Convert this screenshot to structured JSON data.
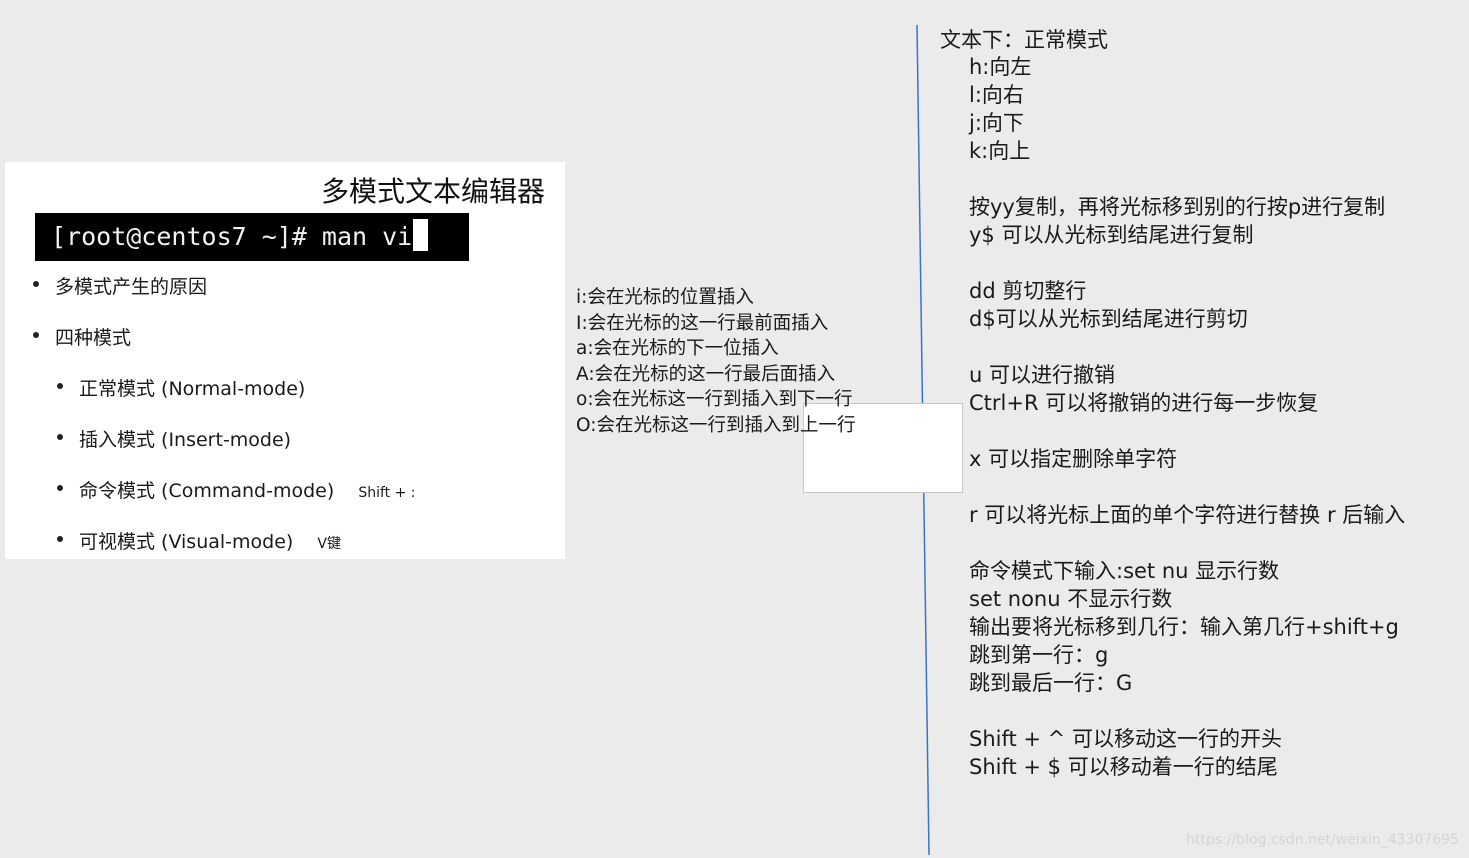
{
  "slide": {
    "title": "多模式文本编辑器",
    "terminal_prompt": "[root@centos7 ~]# man vi",
    "bullets": [
      {
        "label": "多模式产生的原因"
      },
      {
        "label": "四种模式"
      }
    ],
    "modes": [
      {
        "label": "正常模式 (Normal-mode)",
        "note": ""
      },
      {
        "label": "插入模式 (Insert-mode)",
        "note": ""
      },
      {
        "label": "命令模式 (Command-mode)",
        "note": "Shift + :"
      },
      {
        "label": "可视模式 (Visual-mode)",
        "note": "V键"
      }
    ]
  },
  "insert_notes": [
    "i:会在光标的位置插入",
    "I:会在光标的这一行最前面插入",
    "a:会在光标的下一位插入",
    "A:会在光标的这一行最后面插入",
    "o:会在光标这一行到插入到下一行",
    "O:会在光标这一行到插入到上一行"
  ],
  "normal_mode": {
    "heading": "文本下：正常模式",
    "lines": [
      "h:向左",
      "l:向右",
      "j:向下",
      "k:向上",
      "",
      "按yy复制，再将光标移到别的行按p进行复制",
      "y$ 可以从光标到结尾进行复制",
      "",
      "dd 剪切整行",
      "d$可以从光标到结尾进行剪切",
      "",
      "u 可以进行撤销",
      "Ctrl+R 可以将撤销的进行每一步恢复",
      "",
      "x 可以指定删除单字符",
      "",
      "r 可以将光标上面的单个字符进行替换 r 后输入",
      "",
      "命令模式下输入:set nu 显示行数",
      "set nonu 不显示行数",
      "输出要将光标移到几行：输入第几行+shift+g",
      "跳到第一行：g",
      "跳到最后一行：G",
      "",
      "Shift + ^  可以移动这一行的开头",
      "Shift + $  可以移动着一行的结尾"
    ]
  },
  "watermark": "https://blog.csdn.net/weixin_43307695",
  "colors": {
    "background": "#ebebeb",
    "slide": "#ffffff",
    "terminal": "#000000",
    "connector": "#3b73c4",
    "divider": "#3b73c4"
  }
}
